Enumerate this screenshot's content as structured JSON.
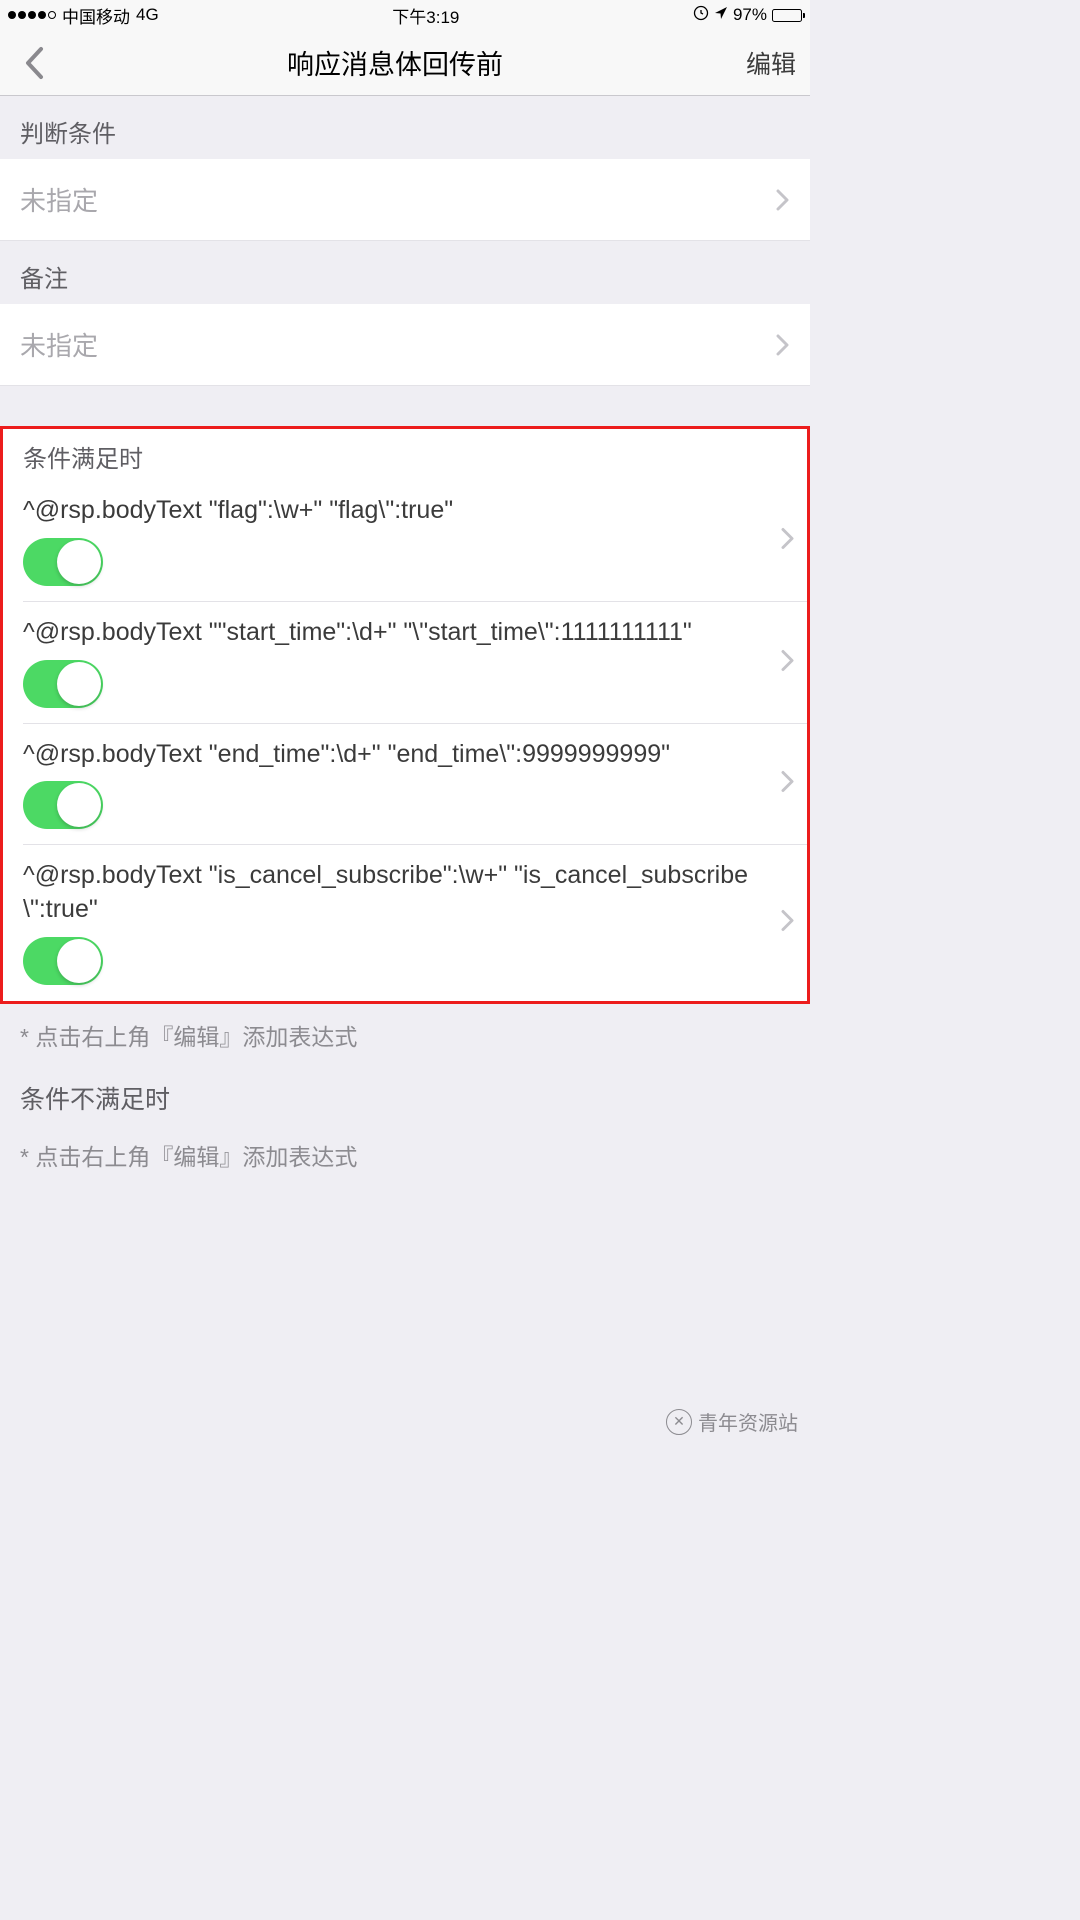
{
  "status": {
    "carrier": "中国移动",
    "network": "4G",
    "time": "下午3:19",
    "battery": "97%"
  },
  "nav": {
    "title": "响应消息体回传前",
    "action": "编辑"
  },
  "sections": {
    "condition_header": "判断条件",
    "condition_value": "未指定",
    "remark_header": "备注",
    "remark_value": "未指定",
    "when_met_header": "条件满足时",
    "when_not_met_header": "条件不满足时",
    "hint_edit": "* 点击右上角『编辑』添加表达式"
  },
  "rules": [
    {
      "text": "^@rsp.bodyText \"flag\":\\w+\" \"flag\\\":true\"",
      "on": true
    },
    {
      "text": "^@rsp.bodyText \"\"start_time\":\\d+\" \"\\\"start_time\\\":1111111111\"",
      "on": true
    },
    {
      "text": "^@rsp.bodyText \"end_time\":\\d+\" \"end_time\\\":9999999999\"",
      "on": true
    },
    {
      "text": "^@rsp.bodyText \"is_cancel_subscribe\":\\w+\" \"is_cancel_subscribe\\\":true\"",
      "on": true
    }
  ],
  "watermark": "青年资源站"
}
